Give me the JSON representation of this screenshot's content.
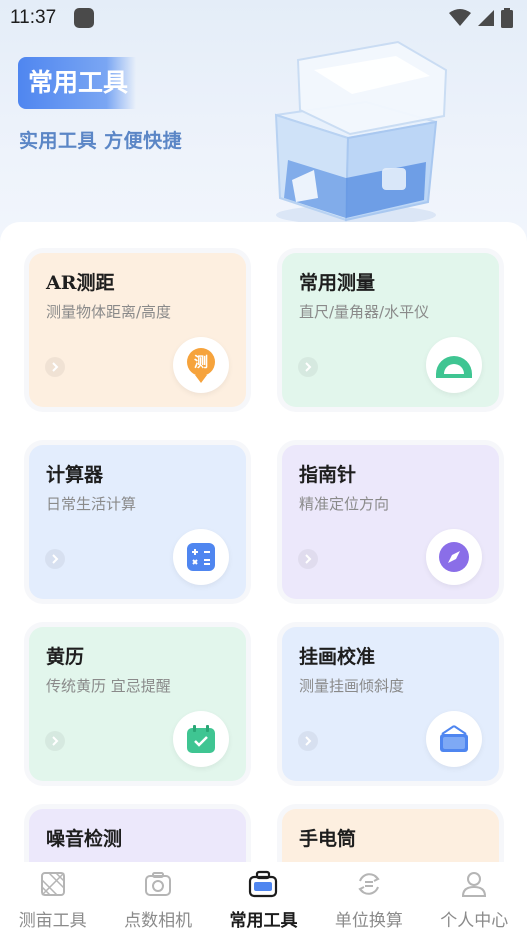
{
  "status_bar": {
    "time": "11:37"
  },
  "hero": {
    "title": "常用工具",
    "subtitle": "实用工具 方便快捷"
  },
  "cards": [
    {
      "title": "AR测距",
      "subtitle": "测量物体距离/高度",
      "icon": "ar-measure-icon",
      "icon_char": "测",
      "bg": "#fdefe0"
    },
    {
      "title": "常用测量",
      "subtitle": "直尺/量角器/水平仪",
      "icon": "protractor-icon",
      "bg": "#e2f6ec"
    },
    {
      "title": "计算器",
      "subtitle": "日常生活计算",
      "icon": "calculator-icon",
      "bg": "#e3edfd"
    },
    {
      "title": "指南针",
      "subtitle": "精准定位方向",
      "icon": "compass-icon",
      "bg": "#ece8fb"
    },
    {
      "title": "黄历",
      "subtitle": "传统黄历 宜忌提醒",
      "icon": "calendar-icon",
      "bg": "#e2f6ec"
    },
    {
      "title": "挂画校准",
      "subtitle": "测量挂画倾斜度",
      "icon": "hanging-picture-icon",
      "bg": "#e3edfd"
    },
    {
      "title": "噪音检测",
      "subtitle": "",
      "icon": "noise-icon",
      "bg": "#ece8fb"
    },
    {
      "title": "手电筒",
      "subtitle": "",
      "icon": "flashlight-icon",
      "bg": "#fdefe0"
    }
  ],
  "nav": [
    {
      "label": "测亩工具",
      "icon": "field-measure-icon",
      "active": false
    },
    {
      "label": "点数相机",
      "icon": "camera-icon",
      "active": false
    },
    {
      "label": "常用工具",
      "icon": "toolbox-icon",
      "active": true
    },
    {
      "label": "单位换算",
      "icon": "convert-icon",
      "active": false
    },
    {
      "label": "个人中心",
      "icon": "person-icon",
      "active": false
    }
  ],
  "colors": {
    "accent": "#4f86f0",
    "subtitle": "#5b86c6",
    "green": "#3fc592",
    "purple": "#8a6ee8"
  }
}
